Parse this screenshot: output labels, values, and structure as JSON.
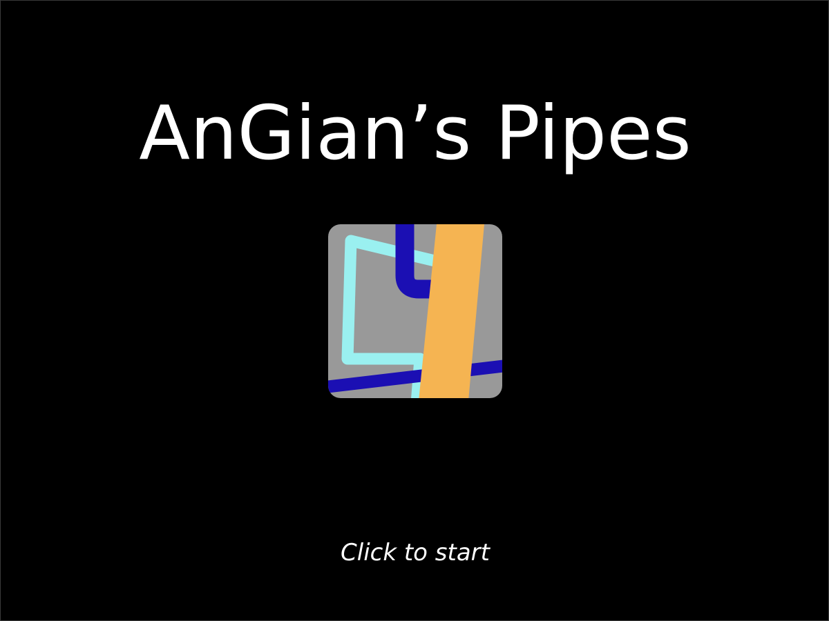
{
  "game": {
    "title": "AnGian’s Pipes",
    "start_prompt": "Click to start"
  },
  "logo": {
    "icon": "pipes-logo-icon",
    "colors": {
      "tile": "#999999",
      "pipe_cyan": "#9af0f0",
      "pipe_navy": "#1b0fb3",
      "pipe_orange": "#f5b452"
    }
  },
  "theme": {
    "background": "#000000",
    "text": "#ffffff"
  }
}
